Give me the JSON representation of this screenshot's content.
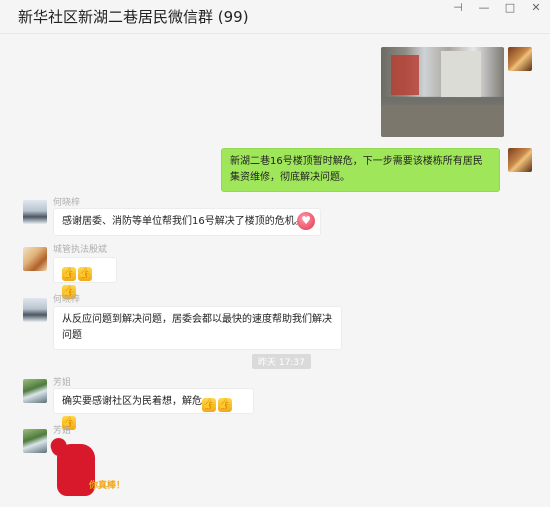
{
  "window": {
    "title": "新华社区新湖二巷居民微信群 (99)",
    "icons": [
      "pin-icon",
      "minimize-icon",
      "maximize-icon",
      "close-icon"
    ]
  },
  "messages": [
    {
      "type": "image",
      "sender": "",
      "direction": "out"
    },
    {
      "type": "text",
      "direction": "out",
      "text": "新湖二巷16号楼顶暂时解危，下一步需要该楼栋所有居民集资维修，彻底解决问题。"
    },
    {
      "type": "text",
      "direction": "in",
      "sender": "何晓梓",
      "text": "感谢居委、消防等单位帮我们16号解决了楼顶的危机。",
      "emoji": "heart"
    },
    {
      "type": "text",
      "direction": "in",
      "sender": "城管执法殷斌",
      "emoji": "thumbs-up x3"
    },
    {
      "type": "text",
      "direction": "in",
      "sender": "何晓梓",
      "text": "从反应问题到解决问题，居委会都以最快的速度帮助我们解决问题"
    },
    {
      "type": "time",
      "text": "昨天 17:37"
    },
    {
      "type": "text",
      "direction": "in",
      "sender": "芳姐",
      "text": "确实要感谢社区为民着想，解危"
    },
    {
      "type": "sticker",
      "direction": "in",
      "sender": "芳姐",
      "text": "你真棒！"
    }
  ],
  "colors": {
    "outgoing_bubble": "#9fe65a",
    "incoming_bubble": "#ffffff",
    "background": "#f5f5f5"
  }
}
